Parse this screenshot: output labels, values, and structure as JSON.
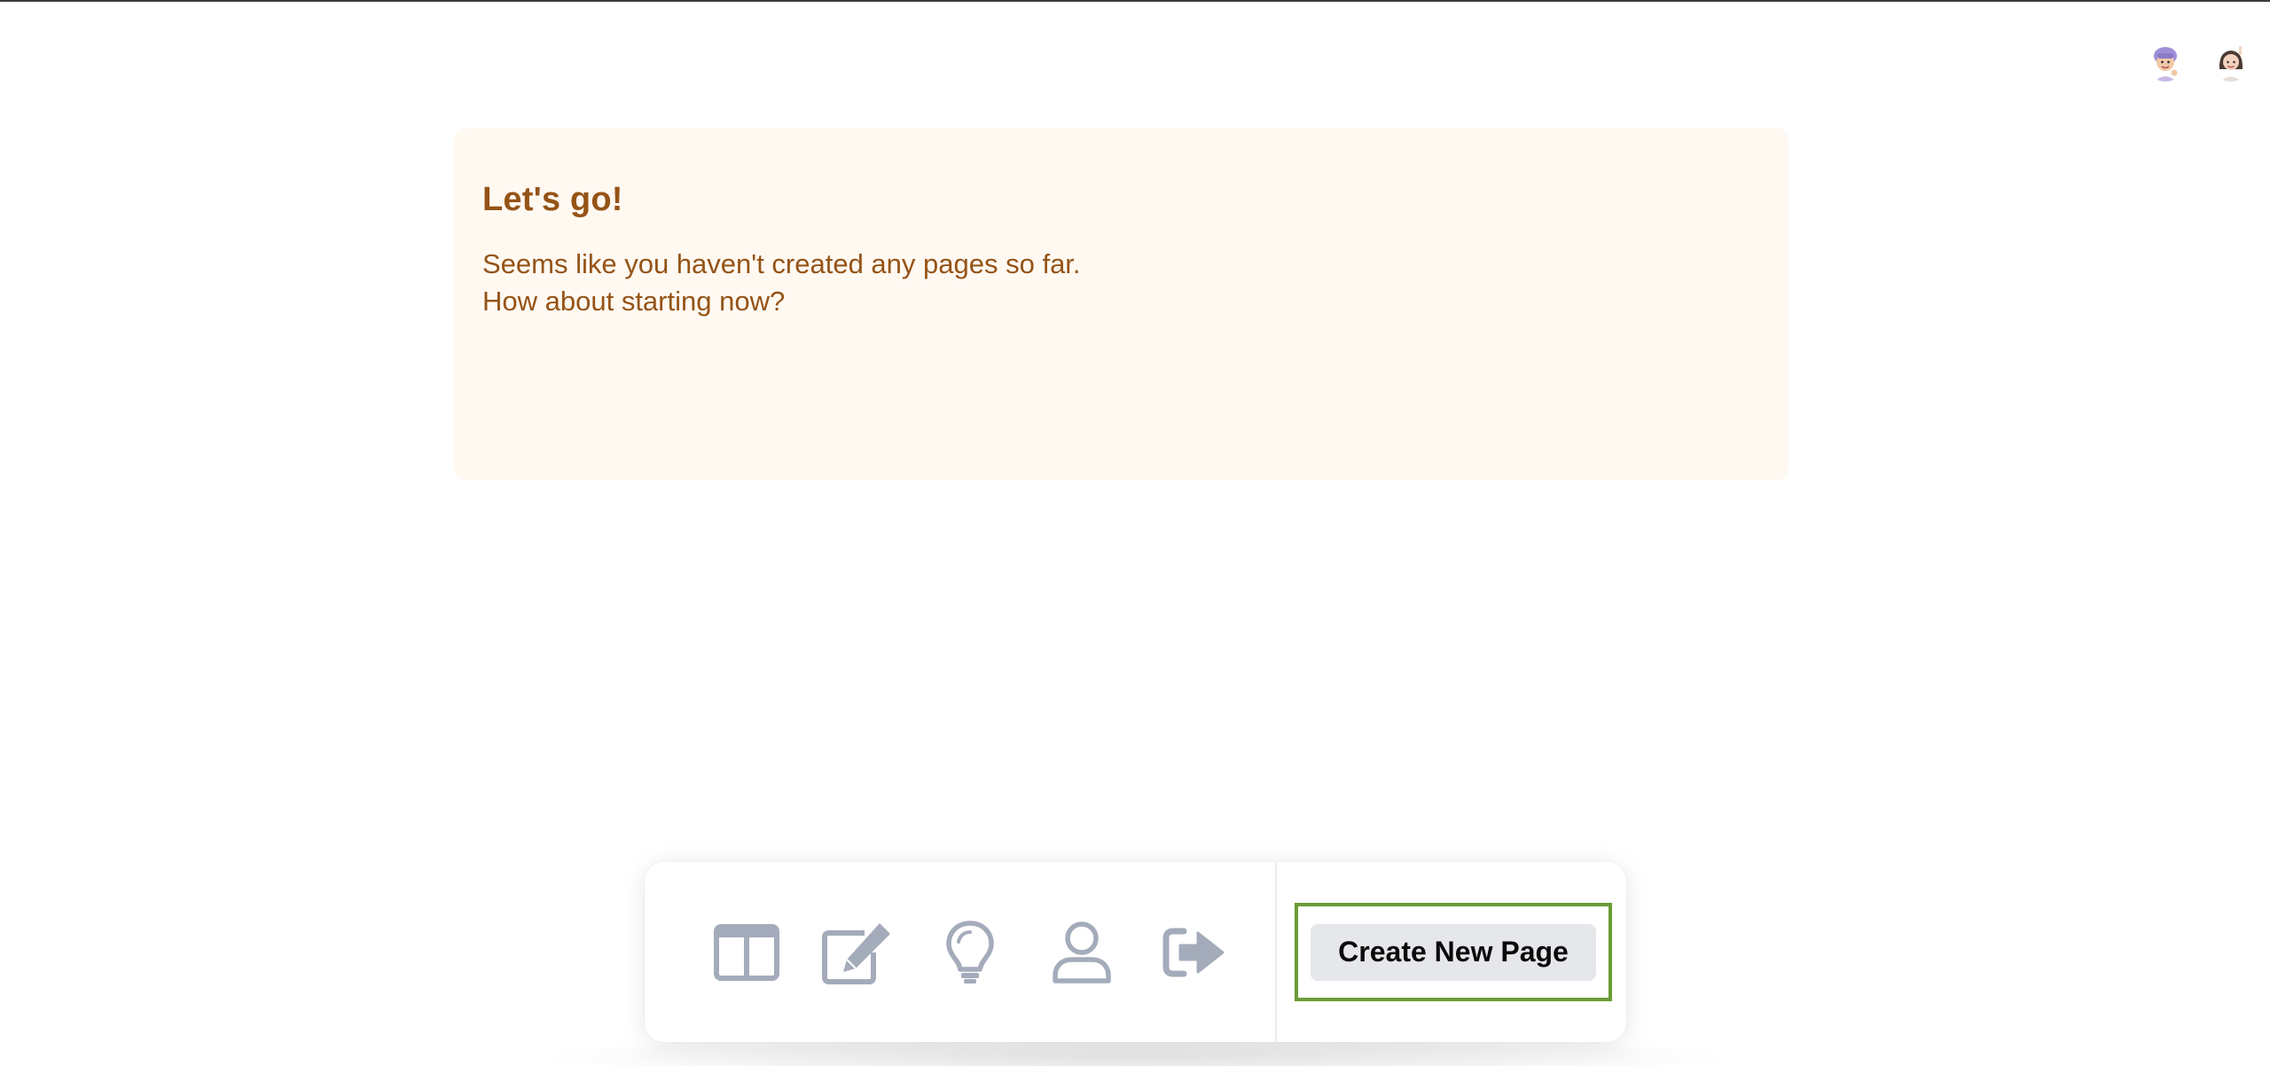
{
  "header": {
    "avatars": [
      {
        "icon": "memoji-avatar-purple-hair"
      },
      {
        "icon": "memoji-avatar-woman"
      }
    ]
  },
  "notice": {
    "title": "Let's go!",
    "line1": "Seems like you haven't created any pages so far.",
    "line2": "How about starting now?",
    "colors": {
      "background": "#fff9f2",
      "text": "#955316"
    }
  },
  "toolbar": {
    "tools": [
      {
        "icon": "columns-layout-icon"
      },
      {
        "icon": "edit-icon"
      },
      {
        "icon": "lightbulb-icon"
      },
      {
        "icon": "user-icon"
      },
      {
        "icon": "sign-out-icon"
      }
    ],
    "create_label": "Create New Page",
    "colors": {
      "icon": "#a4abba",
      "highlight": "#6a9c34",
      "button_bg": "#e6e7eb"
    }
  }
}
